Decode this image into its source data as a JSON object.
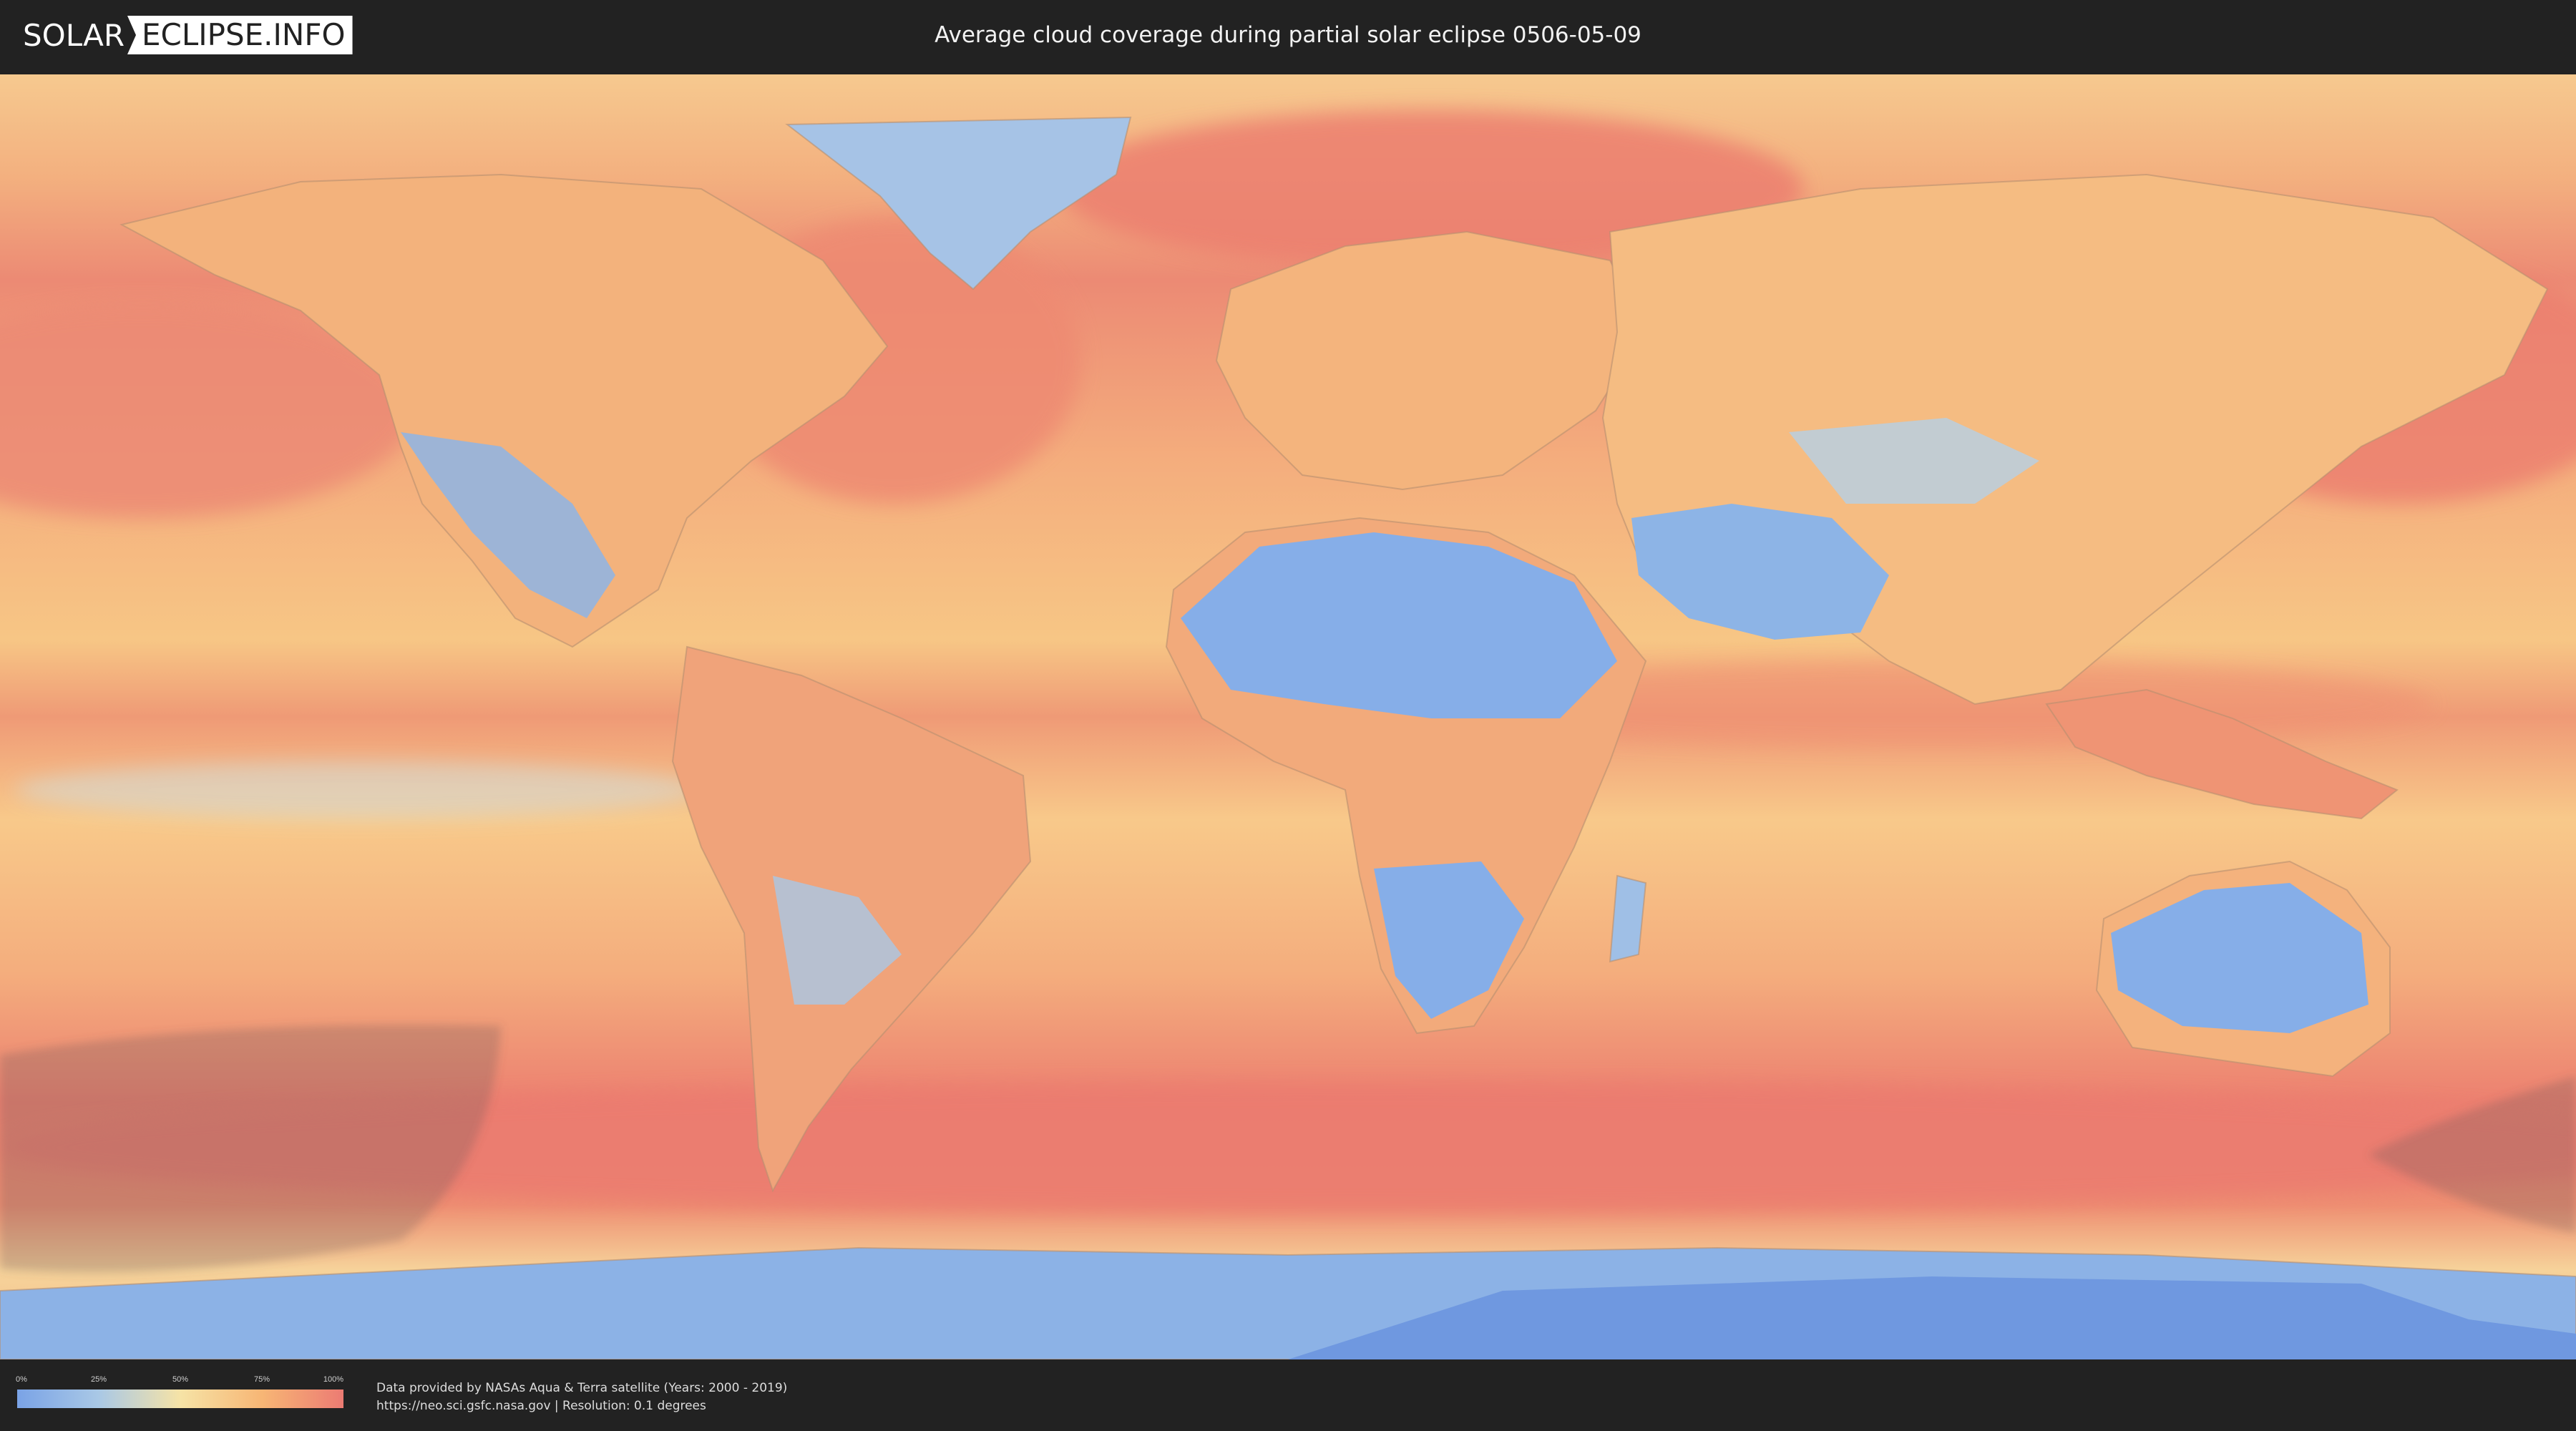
{
  "header": {
    "logo_left": "SOLAR",
    "logo_right": "ECLIPSE.INFO",
    "title": "Average cloud coverage during partial solar eclipse 0506-05-09"
  },
  "legend": {
    "ticks": [
      "0%",
      "25%",
      "50%",
      "75%",
      "100%"
    ],
    "colors": [
      "#7aa3e6",
      "#a9c8e6",
      "#f6e3a6",
      "#f7b675",
      "#ec7b73"
    ]
  },
  "credits": {
    "line1": "Data provided by NASAs Aqua & Terra satellite (Years: 2000 - 2019)",
    "line2": "https://neo.sci.gsfc.nasa.gov | Resolution: 0.1 degrees"
  },
  "map": {
    "layer": "cloud-coverage",
    "projection": "equirectangular",
    "colors": {
      "ocean_high": "#ec8a74",
      "ocean_mid": "#f6b97c",
      "land_low": "#86aee8",
      "ice_low": "#6f98e0",
      "eclipse_shade": "#6b5b55"
    }
  }
}
